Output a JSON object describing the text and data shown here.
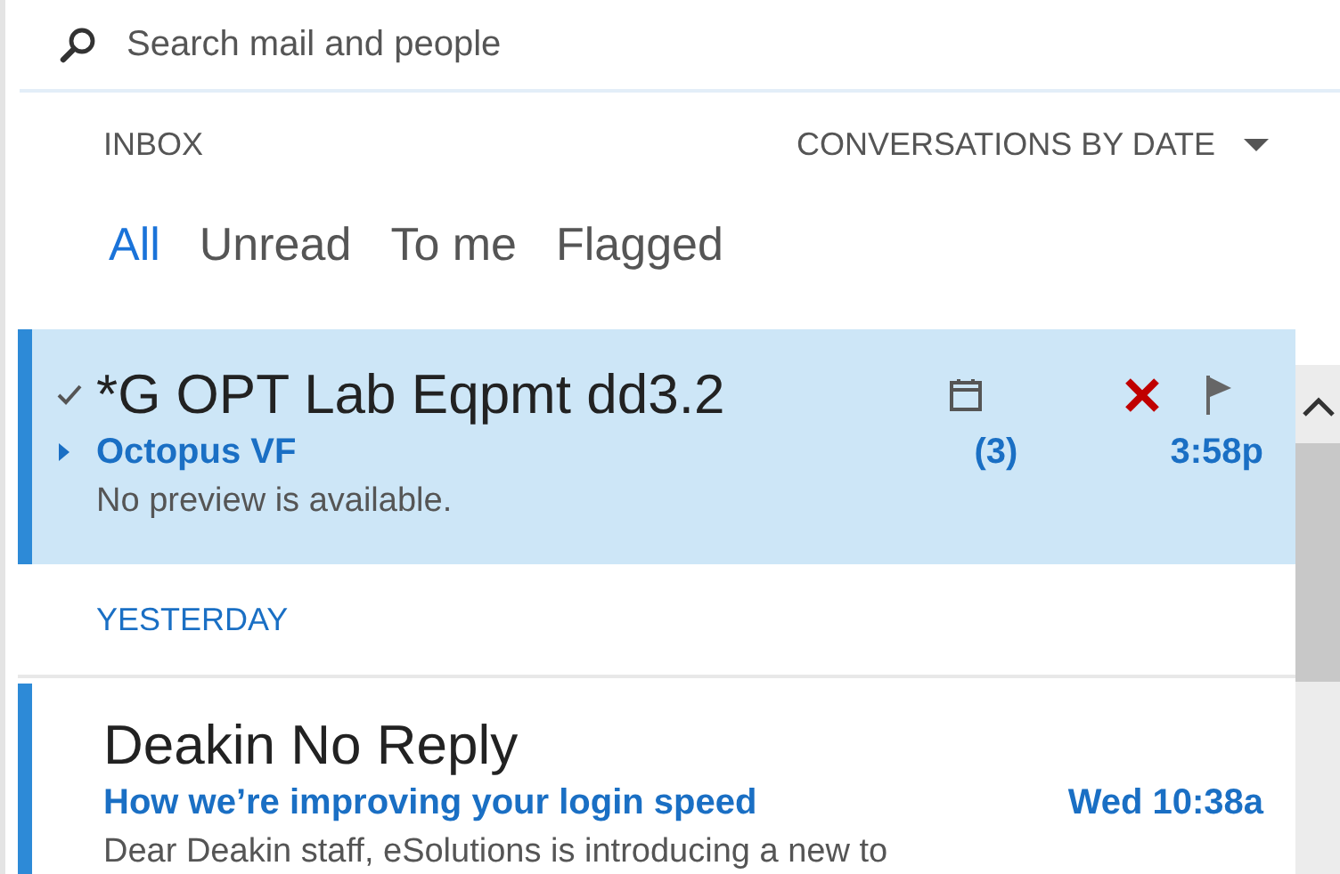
{
  "search": {
    "placeholder": "Search mail and people"
  },
  "folder": "INBOX",
  "sort": {
    "label": "CONVERSATIONS BY DATE"
  },
  "filters": [
    {
      "label": "All",
      "selected": true
    },
    {
      "label": "Unread",
      "selected": false
    },
    {
      "label": "To me",
      "selected": false
    },
    {
      "label": "Flagged",
      "selected": false
    }
  ],
  "items": [
    {
      "kind": "message",
      "selected": true,
      "unread": true,
      "checked": true,
      "conversation": true,
      "title": "*G OPT Lab Eqpmt dd3.2",
      "subtitle": "Octopus VF",
      "count": "(3)",
      "time": "3:58p",
      "preview": "No preview is available."
    },
    {
      "kind": "header",
      "label": "YESTERDAY"
    },
    {
      "kind": "message",
      "selected": false,
      "unread": true,
      "checked": false,
      "conversation": false,
      "title": "Deakin No Reply",
      "subtitle": "How we’re improving your login speed",
      "time": "Wed 10:38a",
      "preview": "Dear Deakin staff, eSolutions is introducing a new to"
    }
  ]
}
